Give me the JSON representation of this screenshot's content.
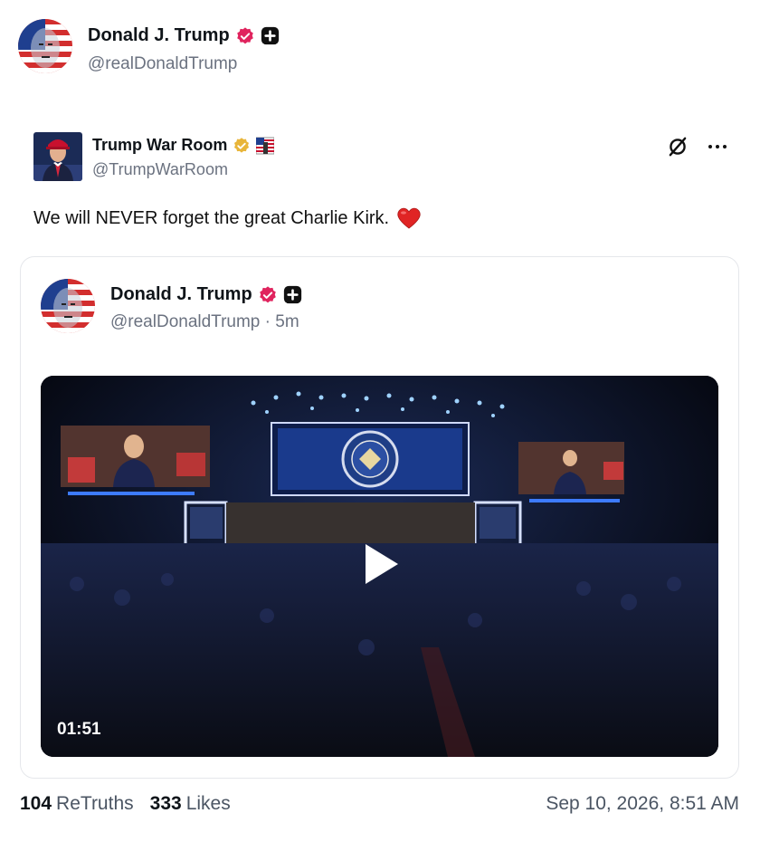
{
  "post": {
    "author": {
      "name": "Donald J. Trump",
      "handle": "@realDonaldTrump"
    }
  },
  "quoted": {
    "author": {
      "name": "Trump War Room",
      "handle": "@TrumpWarRoom"
    },
    "text": "We will NEVER forget the great Charlie Kirk.",
    "emoji": "❤️",
    "icons": {
      "mute": "mute-icon",
      "more": "more-options-icon"
    }
  },
  "embed": {
    "author": {
      "name": "Donald J. Trump",
      "handle": "@realDonaldTrump · 5m"
    },
    "video": {
      "duration": "01:51"
    }
  },
  "stats": {
    "retruths_count": "104",
    "retruths_label": "ReTruths",
    "likes_count": "333",
    "likes_label": "Likes",
    "timestamp": "Sep 10, 2026, 8:51 AM"
  },
  "colors": {
    "verified_pink": "#e0245e",
    "verified_gold": "#e8b53a",
    "text": "#0f1419",
    "muted": "#6b7280"
  }
}
